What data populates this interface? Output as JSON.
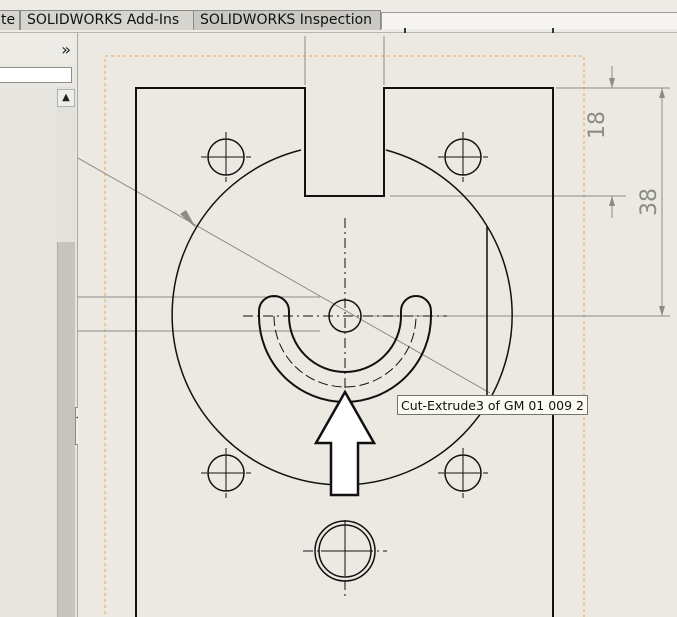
{
  "tabs": [
    {
      "label": "te"
    },
    {
      "label": "SOLIDWORKS Add-Ins"
    },
    {
      "label": "SOLIDWORKS Inspection"
    }
  ],
  "panel": {
    "toggle_icon": "double-chevron-right-icon",
    "toggle_glyph": "»",
    "scroll_up_glyph": "▲",
    "splitter_glyph": "◂◂◂"
  },
  "drawing": {
    "dimensions": [
      {
        "value": "18"
      },
      {
        "value": "38"
      }
    ],
    "tooltip": "Cut-Extrude3 of GM 01 009 2",
    "colors": {
      "line": "#111111",
      "dimension": "#8b8b87",
      "sheet_border": "#f0a050",
      "arrow_fill": "#ffffff"
    }
  }
}
